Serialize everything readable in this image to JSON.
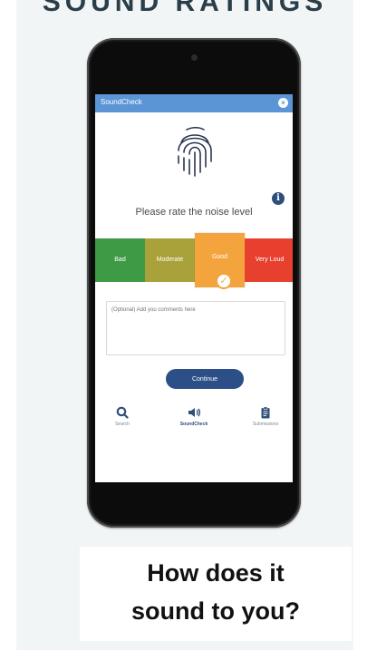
{
  "slide": {
    "heading": "SOUND RATINGS",
    "caption_line1": "How does it",
    "caption_line2": "sound to you?"
  },
  "app": {
    "title": "SoundCheck",
    "close_symbol": "×",
    "info_symbol": "i",
    "prompt": "Please rate the noise level",
    "ratings": [
      {
        "label": "Bad",
        "color": "#3f9a45"
      },
      {
        "label": "Moderate",
        "color": "#a9a13a"
      },
      {
        "label": "Good",
        "color": "#f4a43c",
        "selected": true
      },
      {
        "label": "Very Loud",
        "color": "#e8402e"
      }
    ],
    "check_symbol": "✓",
    "comment_placeholder": "(Optional) Add you comments here",
    "continue_label": "Continue",
    "nav": [
      {
        "label": "Search",
        "icon": "search-icon"
      },
      {
        "label": "SoundCheck",
        "icon": "speaker-icon",
        "active": true
      },
      {
        "label": "Submissions",
        "icon": "clipboard-icon"
      }
    ]
  },
  "colors": {
    "app_bar": "#5b95d6",
    "primary": "#2b4f86",
    "panel_bg": "#f2f5f6"
  }
}
